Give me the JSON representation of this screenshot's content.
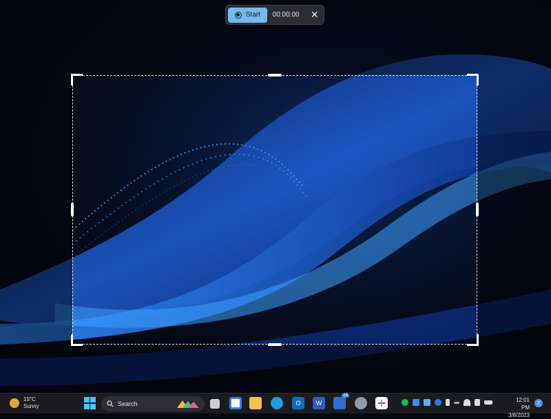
{
  "recorder": {
    "start_label": "Start",
    "timer": "00:00:00",
    "record_icon": "record-icon",
    "close_icon": "close-icon"
  },
  "taskbar": {
    "weather": {
      "temp": "15°C",
      "condition": "Sunny",
      "icon": "sun-icon"
    },
    "search_label": "Search",
    "store_badge": "18",
    "clock": {
      "time": "12:01 PM",
      "date": "3/8/2023"
    },
    "notification_count": "2"
  },
  "colors": {
    "accent": "#76b9ed",
    "wallpaper_dark": "#050a18",
    "wave_blue": "#1e5fd6",
    "taskbar": "#1c1c20"
  }
}
